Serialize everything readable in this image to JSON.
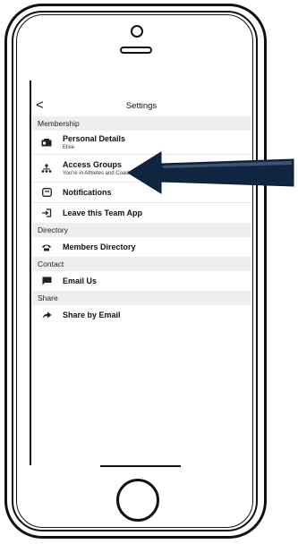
{
  "header": {
    "back": "<",
    "title": "Settings"
  },
  "sections": {
    "membership": "Membership",
    "directory": "Directory",
    "contact": "Contact",
    "share": "Share"
  },
  "items": {
    "personal_details": {
      "label": "Personal Details",
      "sub": "Elise"
    },
    "access_groups": {
      "label": "Access Groups",
      "sub": "You're in Athletes and Coaches"
    },
    "notifications": {
      "label": "Notifications"
    },
    "leave_team": {
      "label": "Leave this Team App"
    },
    "members_directory": {
      "label": "Members Directory"
    },
    "email_us": {
      "label": "Email Us"
    },
    "share_email": {
      "label": "Share by Email"
    }
  },
  "icons": {
    "personal": "id-card-icon",
    "access": "hierarchy-icon",
    "notifications": "notification-icon",
    "leave": "exit-icon",
    "directory": "phone-icon",
    "email": "chat-icon",
    "share": "share-arrow-icon"
  },
  "colors": {
    "section_bg": "#eeeeee",
    "arrow_fill": "#0f2540"
  }
}
